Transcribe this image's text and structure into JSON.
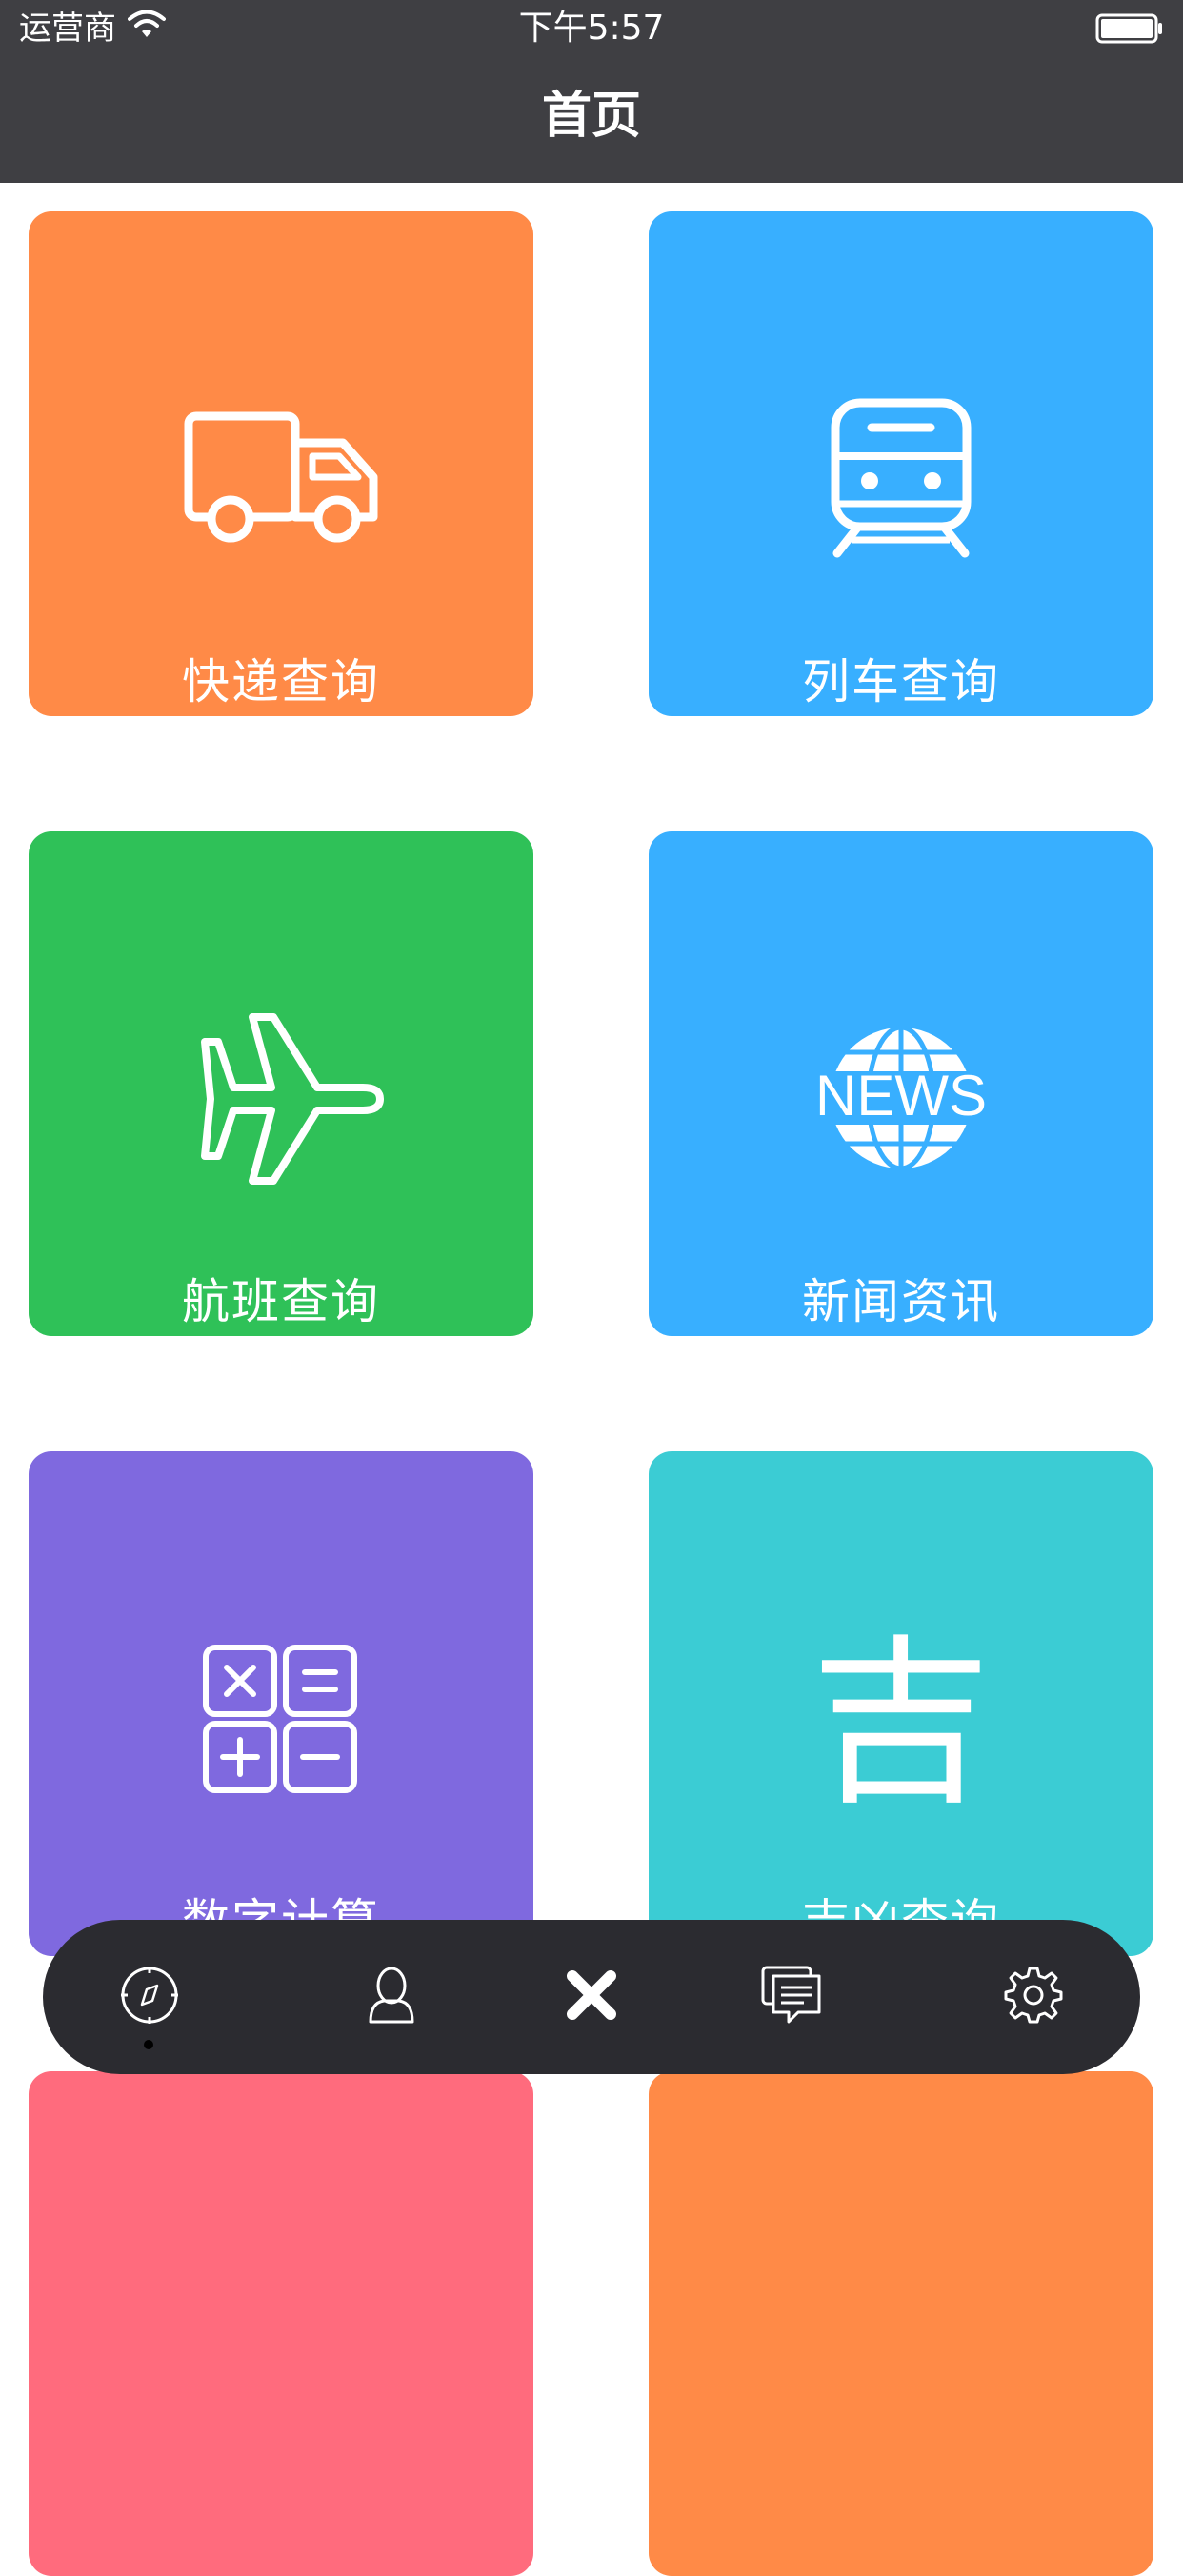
{
  "status_bar": {
    "carrier": "运营商",
    "time": "下午5:57"
  },
  "nav": {
    "title": "首页"
  },
  "tiles": [
    {
      "label": "快递查询",
      "icon": "truck-icon",
      "color": "#ff8a47"
    },
    {
      "label": "列车查询",
      "icon": "train-icon",
      "color": "#38afff"
    },
    {
      "label": "航班查询",
      "icon": "airplane-icon",
      "color": "#2fc158"
    },
    {
      "label": "新闻资讯",
      "icon": "news-globe-icon",
      "icon_text": "NEWS",
      "color": "#38afff"
    },
    {
      "label": "数字计算",
      "icon": "calculator-icon",
      "color": "#7f69df"
    },
    {
      "label": "吉凶查询",
      "icon": "ji-character-icon",
      "icon_text": "吉",
      "color": "#3bccd4"
    },
    {
      "label": "",
      "icon": "",
      "color": "#ff6b7d"
    },
    {
      "label": "",
      "icon": "",
      "color": "#ff8a47"
    }
  ],
  "tab_bar": {
    "items": [
      {
        "icon": "compass-icon",
        "selected": true
      },
      {
        "icon": "person-icon",
        "selected": false
      },
      {
        "icon": "close-icon",
        "selected": false
      },
      {
        "icon": "chat-icon",
        "selected": false
      },
      {
        "icon": "gear-icon",
        "selected": false
      }
    ],
    "background": "#2b2b30"
  }
}
